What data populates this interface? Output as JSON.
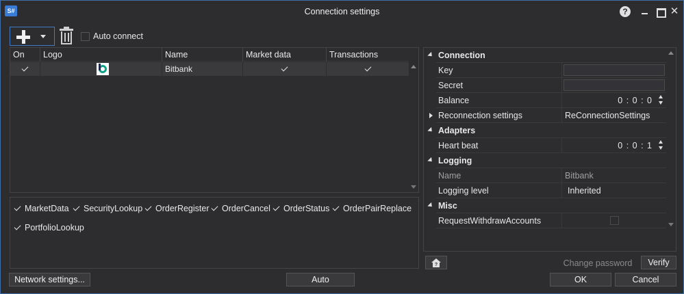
{
  "window": {
    "app_icon_text": "S#",
    "title": "Connection settings",
    "help_symbol": "?",
    "close_symbol": "✕"
  },
  "toolbar": {
    "auto_connect_label": "Auto connect"
  },
  "grid": {
    "columns": [
      "On",
      "Logo",
      "Name",
      "Market data",
      "Transactions"
    ],
    "rows": [
      {
        "on": true,
        "logo_icon": "bitbank-logo-icon",
        "name": "Bitbank",
        "market_data": true,
        "transactions": true
      }
    ]
  },
  "message_types": [
    "MarketData",
    "SecurityLookup",
    "OrderRegister",
    "OrderCancel",
    "OrderStatus",
    "OrderPairReplace",
    "PortfolioLookup"
  ],
  "properties": {
    "cat_connection": "Connection",
    "key_label": "Key",
    "secret_label": "Secret",
    "balance_label": "Balance",
    "balance_value": "0 : 0 : 0",
    "reconnection_label": "Reconnection settings",
    "reconnection_value": "ReConnectionSettings",
    "cat_adapters": "Adapters",
    "heartbeat_label": "Heart beat",
    "heartbeat_value": "0 : 0 : 1",
    "cat_logging": "Logging",
    "log_name_label": "Name",
    "log_name_value": "Bitbank",
    "log_level_label": "Logging level",
    "log_level_value": "Inherited",
    "cat_misc": "Misc",
    "withdraw_label": "RequestWithdrawAccounts"
  },
  "buttons": {
    "change_password": "Change password",
    "verify": "Verify",
    "network_settings": "Network settings...",
    "auto": "Auto",
    "ok": "OK",
    "cancel": "Cancel"
  },
  "colors": {
    "background": "#2d2d30",
    "accent_border": "#3f7bc7",
    "selected_row": "#3a3a3d"
  }
}
